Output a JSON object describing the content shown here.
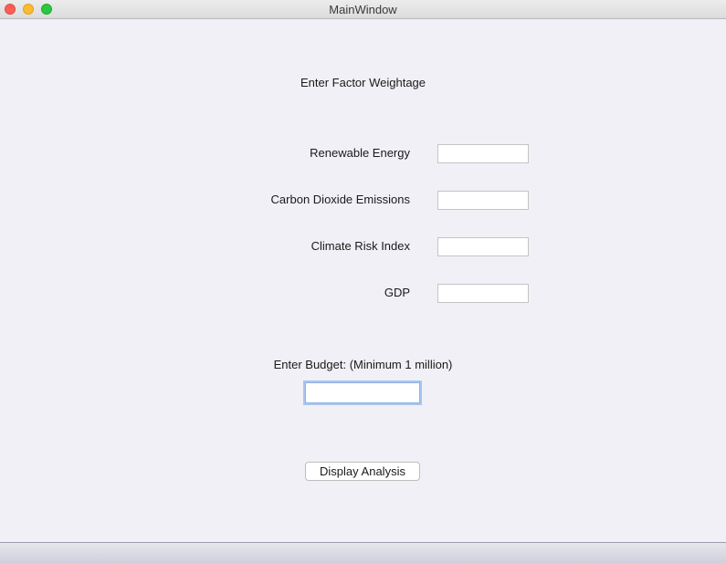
{
  "window": {
    "title": "MainWindow"
  },
  "form": {
    "heading": "Enter Factor Weightage",
    "fields": [
      {
        "label": "Renewable Energy",
        "value": ""
      },
      {
        "label": "Carbon Dioxide Emissions",
        "value": ""
      },
      {
        "label": "Climate Risk Index",
        "value": ""
      },
      {
        "label": "GDP",
        "value": ""
      }
    ],
    "budget_label": "Enter Budget: (Minimum 1 million)",
    "budget_value": "",
    "action_label": "Display Analysis"
  },
  "colors": {
    "close": "#fc5f57",
    "minimize": "#fdbb2e",
    "maximize": "#29c840",
    "focus_ring": "#a8c6ee"
  }
}
